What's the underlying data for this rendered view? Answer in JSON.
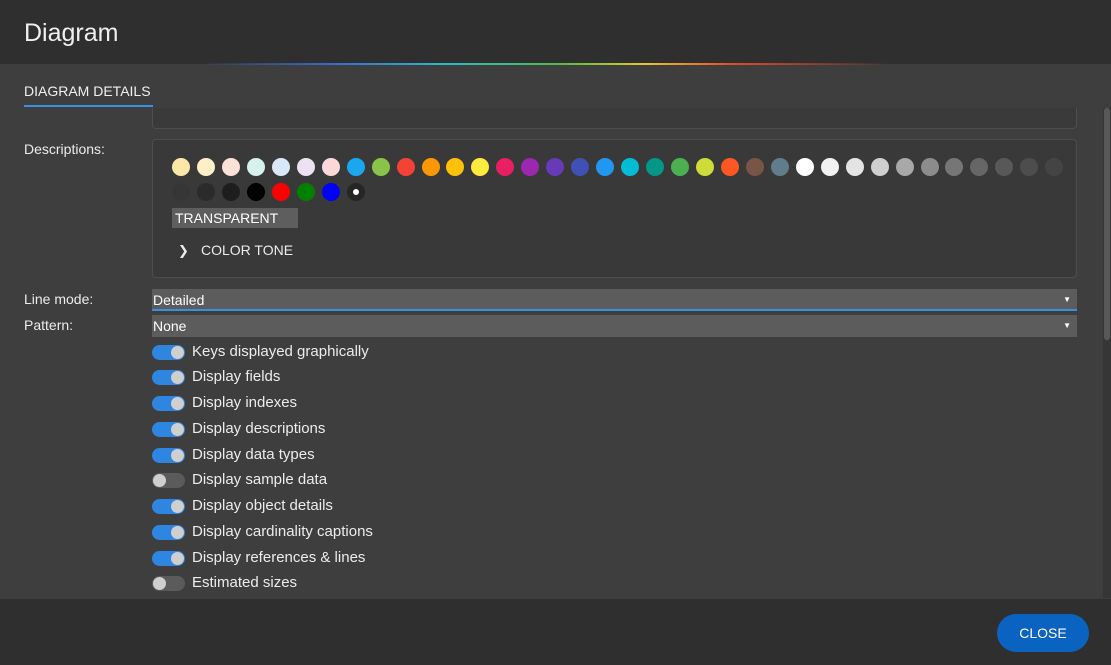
{
  "window": {
    "title": "Diagram"
  },
  "tabs": [
    {
      "label": "DIAGRAM DETAILS"
    }
  ],
  "descriptions": {
    "label": "Descriptions:",
    "swatches": [
      "#fde7a6",
      "#fdf0c8",
      "#fde0d6",
      "#d7f2ec",
      "#d8e8f8",
      "#ece0f2",
      "#fbd9d9",
      "#1aa7f0",
      "#8bc34a",
      "#f44336",
      "#ff9800",
      "#ffc107",
      "#ffeb3b",
      "#e91e63",
      "#9c27b0",
      "#673ab7",
      "#3f51b5",
      "#2196f3",
      "#00bcd4",
      "#009688",
      "#4caf50",
      "#cddc39",
      "#ff5722",
      "#795548",
      "#607d8b",
      "#ffffff",
      "#f2f2f2",
      "#e4e4e4",
      "#cfcfcf",
      "#a8a8a8",
      "#8c8c8c",
      "#767676",
      "#666666",
      "#585858",
      "#4d4d4d",
      "#444444",
      "#363636",
      "#2b2b2b",
      "#1e1e1e",
      "#000000",
      "#ff0000",
      "#008000",
      "#0000ff",
      "#262626"
    ],
    "selected_index": 43,
    "transparent_label": "TRANSPARENT",
    "color_tone_label": "COLOR TONE"
  },
  "line_mode": {
    "label": "Line mode:",
    "value": "Detailed"
  },
  "pattern": {
    "label": "Pattern:",
    "value": "None"
  },
  "toggles": [
    {
      "label": "Keys displayed graphically",
      "on": true
    },
    {
      "label": "Display fields",
      "on": true
    },
    {
      "label": "Display indexes",
      "on": true
    },
    {
      "label": "Display descriptions",
      "on": true
    },
    {
      "label": "Display data types",
      "on": true
    },
    {
      "label": "Display sample data",
      "on": false
    },
    {
      "label": "Display object details",
      "on": true
    },
    {
      "label": "Display cardinality captions",
      "on": true
    },
    {
      "label": "Display references & lines",
      "on": true
    },
    {
      "label": "Estimated sizes",
      "on": false
    }
  ],
  "footer": {
    "close_label": "CLOSE"
  }
}
